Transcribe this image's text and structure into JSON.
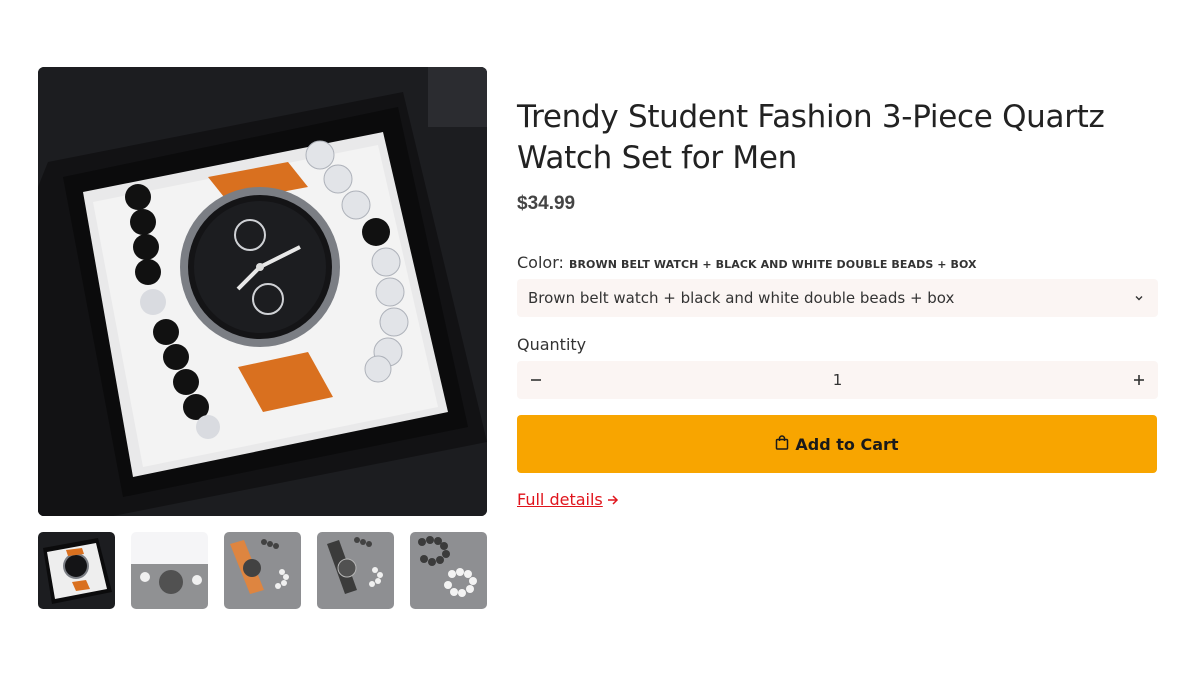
{
  "product": {
    "title": "Trendy Student Fashion 3-Piece Quartz Watch Set for Men",
    "price": "$34.99"
  },
  "variant": {
    "label": "Color:",
    "selected": "BROWN BELT WATCH + BLACK AND WHITE DOUBLE BEADS + BOX",
    "select_value": "Brown belt watch + black and white double beads + box"
  },
  "quantity": {
    "label": "Quantity",
    "value": "1",
    "decrement": "−",
    "increment": "+"
  },
  "actions": {
    "add_to_cart": "Add to Cart",
    "full_details": "Full details"
  },
  "gallery": {
    "thumbnail_count": 5,
    "active_index": 0
  },
  "colors": {
    "accent": "#f8a500",
    "link": "#e0141c",
    "field_bg": "#fbf5f3"
  },
  "icons": [
    "shopping-bag-icon",
    "chevron-down-icon",
    "arrow-right-icon",
    "minus-icon",
    "plus-icon"
  ]
}
